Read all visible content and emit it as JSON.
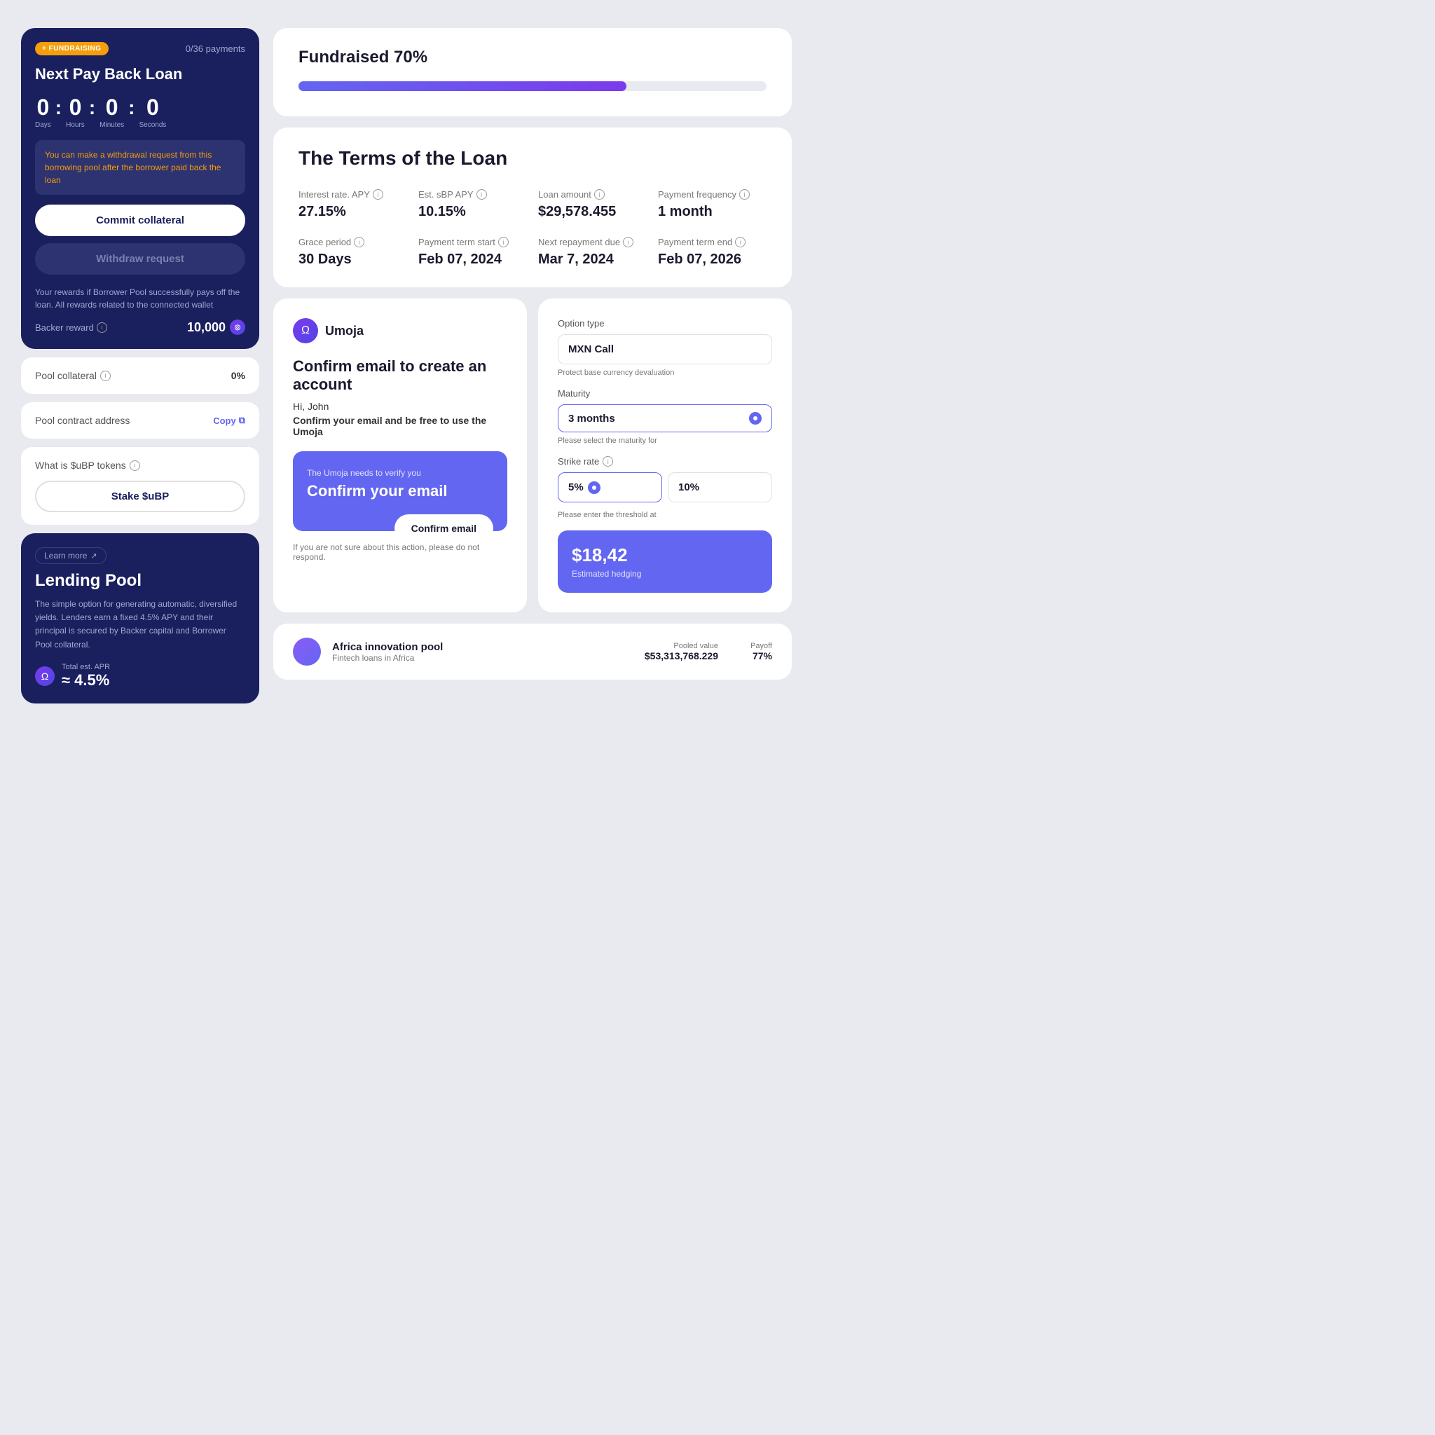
{
  "left": {
    "fundraising_badge": "+ FUNDRAISING",
    "payments_label": "0/36 payments",
    "card_title": "Next Pay Back Loan",
    "countdown": {
      "days": "0",
      "hours": "0",
      "minutes": "0",
      "seconds": "0",
      "days_label": "Days",
      "hours_label": "Hours",
      "minutes_label": "Minutes",
      "seconds_label": "Seconds"
    },
    "warning_text": "You can make a withdrawal request from this borrowing pool after the borrower paid back the loan",
    "commit_btn": "Commit collateral",
    "withdraw_btn": "Withdraw request",
    "rewards_text": "Your rewards if Borrower Pool successfully pays off the loan. All rewards related to the connected wallet",
    "backer_reward_label": "Backer reward",
    "backer_reward_value": "10,000",
    "pool_collateral_label": "Pool collateral",
    "pool_collateral_value": "0%",
    "pool_contract_label": "Pool contract address",
    "copy_label": "Copy",
    "subp_label": "What is $uBP tokens",
    "stake_btn": "Stake $uBP",
    "learn_more": "Learn more",
    "lending_title": "Lending Pool",
    "lending_desc": "The simple option for generating automatic, diversified yields. Lenders earn a fixed 4.5% APY and their principal is secured by Backer capital and Borrower Pool collateral.",
    "total_apr_label": "Total est. APR",
    "apr_value": "≈ 4.5%"
  },
  "right": {
    "fundraised": {
      "title": "Fundraised 70%",
      "progress_pct": 70
    },
    "terms": {
      "title": "The Terms of the Loan",
      "items": [
        {
          "label": "Interest rate. APY",
          "value": "27.15%"
        },
        {
          "label": "Est. sBP APY",
          "value": "10.15%"
        },
        {
          "label": "Loan amount",
          "value": "$29,578.455"
        },
        {
          "label": "Payment frequency",
          "value": "1 month"
        },
        {
          "label": "Grace period",
          "value": "30 Days"
        },
        {
          "label": "Payment term start",
          "value": "Feb 07, 2024"
        },
        {
          "label": "Next repayment due",
          "value": "Mar 7, 2024"
        },
        {
          "label": "Payment term end",
          "value": "Feb 07, 2026"
        }
      ]
    },
    "email_confirm": {
      "brand": "Umoja",
      "main_title": "Confirm email to create an account",
      "greeting": "Hi, John",
      "sub_text": "Confirm your email and be free to use the Umoja",
      "verify_label": "The Umoja needs to verify you",
      "confirm_title": "Confirm your email",
      "confirm_btn": "Confirm email",
      "footer_text": "If you are not sure about this action, please do not respond."
    },
    "option": {
      "option_type_label": "Option type",
      "option_type_value": "MXN Call",
      "option_hint": "Protect base currency devaluation",
      "maturity_label": "Maturity",
      "maturity_value": "3 months",
      "maturity_hint": "Please select the maturity for",
      "strike_label": "Strike rate",
      "strike_value1": "5%",
      "strike_value2": "10%",
      "strike_hint": "Please enter the threshold at",
      "estimated_value": "$18,42",
      "estimated_label": "Estimated hedging"
    },
    "africa_pool": {
      "name": "Africa innovation pool",
      "sub": "Fintech loans in Africa",
      "pooled_label": "Pooled value",
      "pooled_value": "$53,313,768.229",
      "payoff_label": "Payoff",
      "payoff_value": "77%"
    }
  },
  "icons": {
    "info": "ℹ",
    "copy": "⧉",
    "external": "↗"
  }
}
